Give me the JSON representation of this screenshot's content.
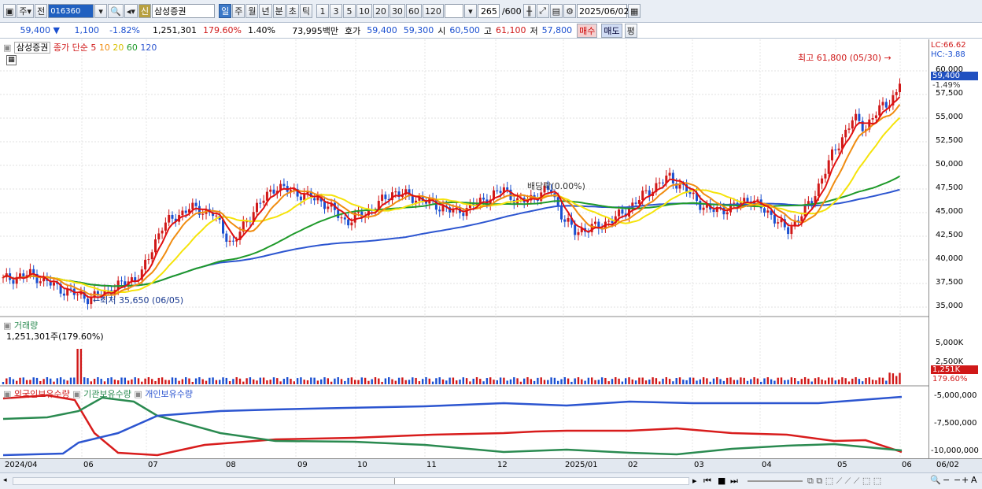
{
  "toolbar": {
    "type_label": "주",
    "prev_label": "전",
    "code": "016360",
    "stock_badge": "신",
    "stock_name": "삼성증권",
    "periods": [
      "일",
      "주",
      "월",
      "년",
      "분",
      "초",
      "틱"
    ],
    "selected_period": "일",
    "intervals": [
      "1",
      "3",
      "5",
      "10",
      "20",
      "30",
      "60",
      "120"
    ],
    "count": "265",
    "count_total": "/600",
    "date": "2025/06/02"
  },
  "quote": {
    "price": "59,400",
    "arrow": "▼",
    "change": "1,100",
    "change_pct": "-1.82%",
    "volume": "1,251,301",
    "vol_ratio": "179.60%",
    "turnover": "1.40%",
    "amount": "73,995백만",
    "hoga_label": "호가",
    "ask": "59,400",
    "bid": "59,300",
    "open_label": "시",
    "open": "60,500",
    "high_label": "고",
    "high": "61,100",
    "low_label": "저",
    "low": "57,800",
    "buy_label": "매수",
    "sell_label": "매도",
    "avg_label": "평"
  },
  "price_panel": {
    "legend_name": "삼성증권",
    "legend_type": "종가 단순",
    "ma_labels": [
      "5",
      "10",
      "20",
      "60",
      "120"
    ],
    "lc": "LC:66.62",
    "hc": "HC:-3.88",
    "current_price": "59,400",
    "current_pct": "-1.49%",
    "high_note": "최고 61,800 (05/30) →",
    "low_note": "←최저 35,650 (06/05)",
    "dividend_note": "배당락(0.00%)",
    "y_ticks": [
      "60,000",
      "57,500",
      "55,000",
      "52,500",
      "50,000",
      "47,500",
      "45,000",
      "42,500",
      "40,000",
      "37,500",
      "35,000"
    ]
  },
  "volume_panel": {
    "title": "거래량",
    "value": "1,251,301주(179.60%)",
    "y_ticks": [
      "5,000K",
      "2,500K"
    ],
    "current": "1,251K",
    "current_pct": "179.60%"
  },
  "holding_panel": {
    "legends": [
      "외국인보유수량",
      "기관보유수량",
      "개인보유수량"
    ],
    "y_ticks": [
      "-5,000,000",
      "-7,500,000",
      "-10,000,000"
    ]
  },
  "x_axis": [
    "2024/04",
    "06",
    "07",
    "08",
    "09",
    "10",
    "11",
    "12",
    "2025/01",
    "02",
    "03",
    "04",
    "05",
    "06",
    "06/02"
  ],
  "colors": {
    "ma5": "#e01010",
    "ma10": "#f08c10",
    "ma20": "#f5e30a",
    "ma60": "#1f9a2a",
    "ma120": "#2c55d0",
    "foreign": "#d81c1c",
    "inst": "#2a8a50",
    "indiv": "#2c55d0"
  }
}
